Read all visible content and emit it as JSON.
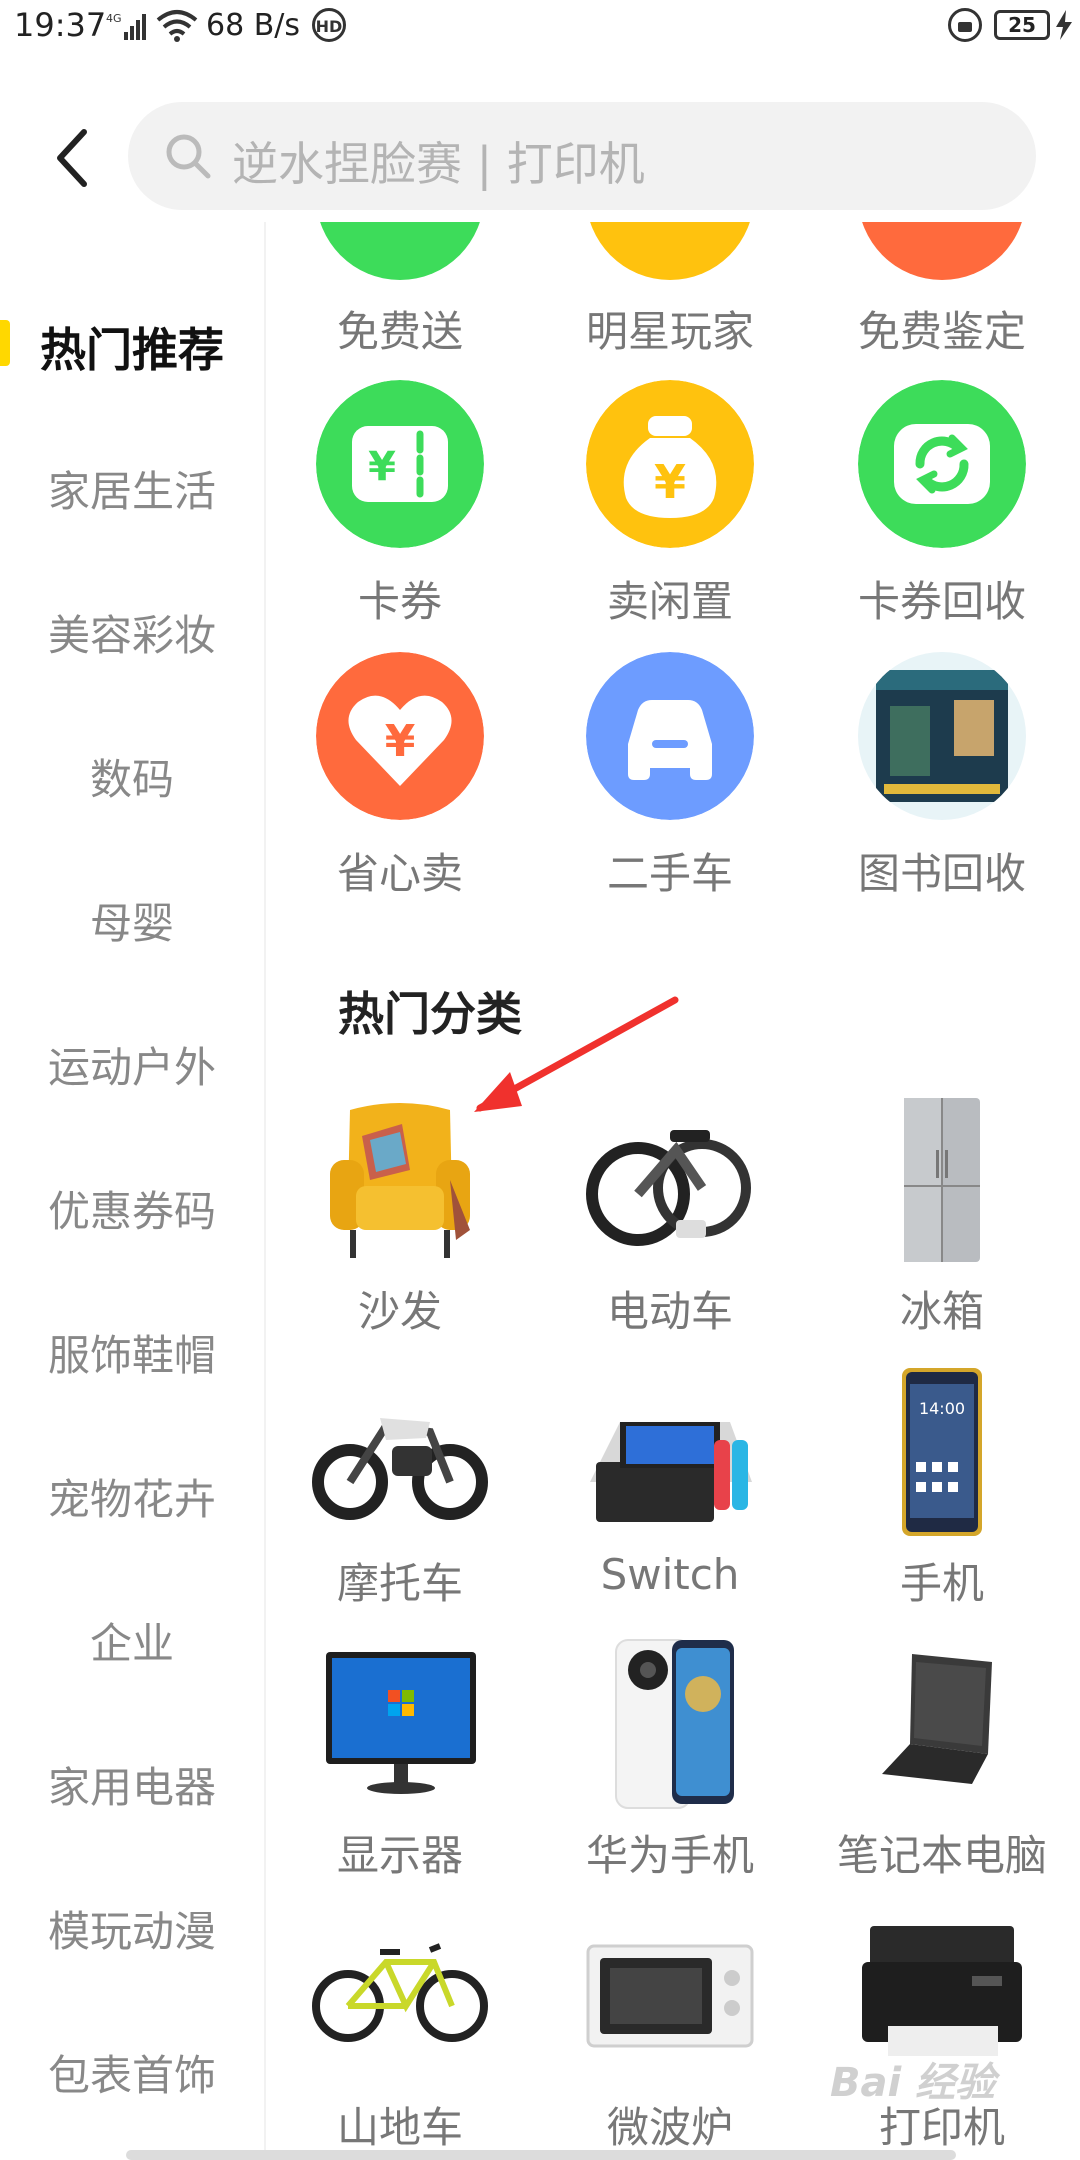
{
  "status_bar": {
    "time": "19:37",
    "network": "4G",
    "speed": "68 B/s",
    "hd": "HD",
    "battery": "25"
  },
  "search": {
    "placeholder": "逆水捏脸赛 | 打印机"
  },
  "sidebar": {
    "items": [
      {
        "label": "热门推荐",
        "active": true
      },
      {
        "label": "家居生活"
      },
      {
        "label": "美容彩妆"
      },
      {
        "label": "数码"
      },
      {
        "label": "母婴"
      },
      {
        "label": "运动户外"
      },
      {
        "label": "优惠券码"
      },
      {
        "label": "服饰鞋帽"
      },
      {
        "label": "宠物花卉"
      },
      {
        "label": "企业"
      },
      {
        "label": "家用电器"
      },
      {
        "label": "模玩动漫"
      },
      {
        "label": "包表首饰"
      }
    ]
  },
  "services": {
    "row0": [
      "免费送",
      "明星玩家",
      "免费鉴定"
    ],
    "row1": [
      "卡券",
      "卖闲置",
      "卡券回收"
    ],
    "row2": [
      "省心卖",
      "二手车",
      "图书回收"
    ],
    "colors": {
      "green": "#3ddc5a",
      "yellow": "#ffc20e",
      "orange": "#ff6a3d",
      "blue": "#6d9cff"
    }
  },
  "categories": {
    "title": "热门分类",
    "items": [
      "沙发",
      "电动车",
      "冰箱",
      "摩托车",
      "Switch",
      "手机",
      "显示器",
      "华为手机",
      "笔记本电脑",
      "山地车",
      "微波炉",
      "打印机"
    ]
  },
  "watermark": "Bai 经验"
}
